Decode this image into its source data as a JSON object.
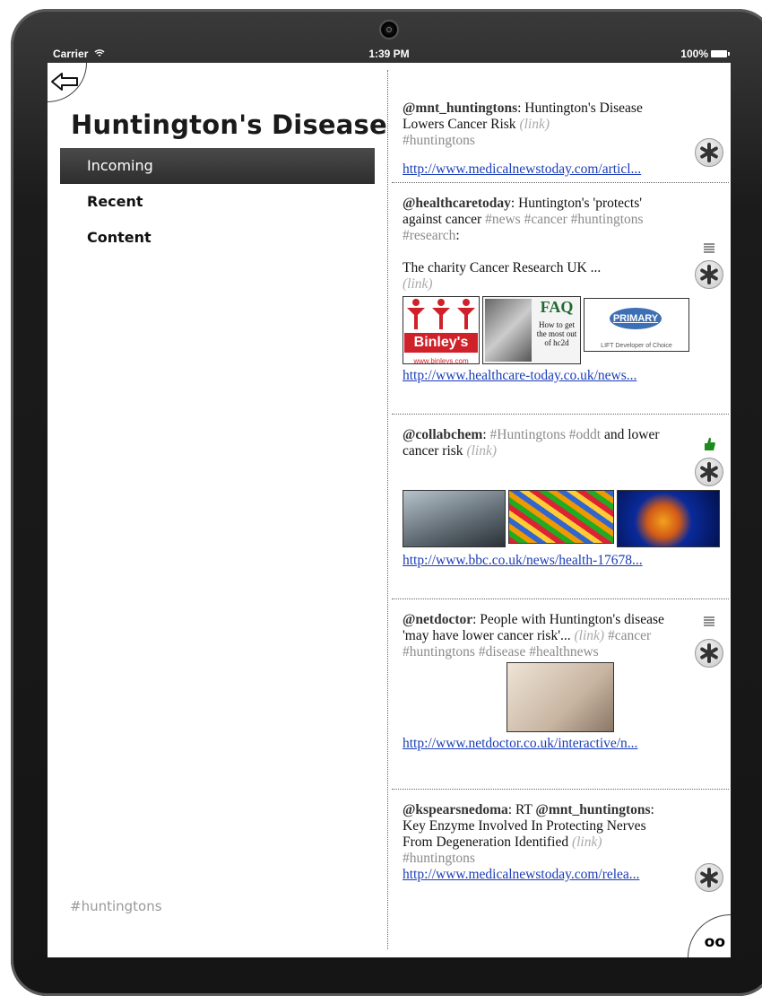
{
  "status": {
    "carrier": "Carrier",
    "time": "1:39 PM",
    "battery": "100%"
  },
  "sidebar": {
    "title": "Huntington's Disease",
    "items": [
      {
        "label": "Incoming",
        "active": true
      },
      {
        "label": "Recent",
        "active": false
      },
      {
        "label": "Content",
        "active": false
      }
    ],
    "footer": "#huntingtons"
  },
  "feed": [
    {
      "handle": "@mnt_huntingtons",
      "text": ": Huntington's Disease Lowers Cancer Risk ",
      "linkword": "(link)",
      "tags": "#huntingtons",
      "url": "http://www.medicalnewstoday.com/articl..."
    },
    {
      "handle": "@healthcaretoday",
      "text": ": Huntington's 'protects' against cancer ",
      "tags": "#news #cancer #huntingtons #research",
      "colon": ":",
      "body": "The charity Cancer Research UK ...",
      "linkword": "(link)",
      "thumbs": [
        "Binley's",
        "www.binleys.com",
        "FAQ",
        "How to get the most out of hc2d",
        "PRIMARY",
        "LIFT Developer of Choice"
      ],
      "url": "http://www.healthcare-today.co.uk/news..."
    },
    {
      "handle": "@collabchem",
      "text": ": ",
      "tags": "#Huntingtons #oddt",
      "text2": " and lower cancer risk ",
      "linkword": "(link)",
      "url": "http://www.bbc.co.uk/news/health-17678..."
    },
    {
      "handle": "@netdoctor",
      "text": ": People with Huntington's disease 'may have lower cancer risk'... ",
      "linkword": "(link)",
      "tags": "#cancer #huntingtons #disease #healthnews",
      "url": "http://www.netdoctor.co.uk/interactive/n..."
    },
    {
      "handle": "@kspearsnedoma",
      "text": ": RT ",
      "handle2": "@mnt_huntingtons",
      "text2": ": Key Enzyme Involved In Protecting Nerves From Degeneration Identified ",
      "linkword": "(link)",
      "tags": "#huntingtons",
      "url": "http://www.medicalnewstoday.com/relea..."
    }
  ],
  "icons": {
    "back": "back-arrow-icon",
    "star": "asterisk-icon",
    "menu": "lines-icon",
    "like": "thumbs-up-icon",
    "corner": "oo"
  }
}
